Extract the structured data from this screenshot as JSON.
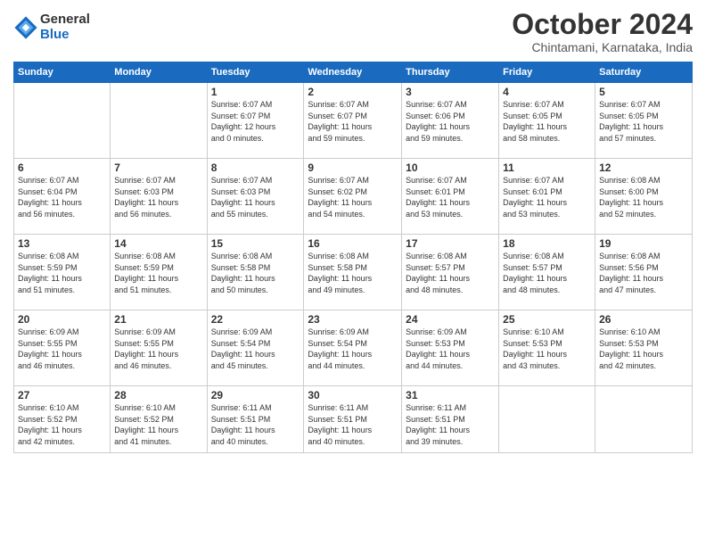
{
  "header": {
    "logo": {
      "general": "General",
      "blue": "Blue"
    },
    "title": "October 2024",
    "location": "Chintamani, Karnataka, India"
  },
  "calendar": {
    "days_of_week": [
      "Sunday",
      "Monday",
      "Tuesday",
      "Wednesday",
      "Thursday",
      "Friday",
      "Saturday"
    ],
    "weeks": [
      [
        {
          "day": "",
          "info": ""
        },
        {
          "day": "",
          "info": ""
        },
        {
          "day": "1",
          "info": "Sunrise: 6:07 AM\nSunset: 6:07 PM\nDaylight: 12 hours\nand 0 minutes."
        },
        {
          "day": "2",
          "info": "Sunrise: 6:07 AM\nSunset: 6:07 PM\nDaylight: 11 hours\nand 59 minutes."
        },
        {
          "day": "3",
          "info": "Sunrise: 6:07 AM\nSunset: 6:06 PM\nDaylight: 11 hours\nand 59 minutes."
        },
        {
          "day": "4",
          "info": "Sunrise: 6:07 AM\nSunset: 6:05 PM\nDaylight: 11 hours\nand 58 minutes."
        },
        {
          "day": "5",
          "info": "Sunrise: 6:07 AM\nSunset: 6:05 PM\nDaylight: 11 hours\nand 57 minutes."
        }
      ],
      [
        {
          "day": "6",
          "info": "Sunrise: 6:07 AM\nSunset: 6:04 PM\nDaylight: 11 hours\nand 56 minutes."
        },
        {
          "day": "7",
          "info": "Sunrise: 6:07 AM\nSunset: 6:03 PM\nDaylight: 11 hours\nand 56 minutes."
        },
        {
          "day": "8",
          "info": "Sunrise: 6:07 AM\nSunset: 6:03 PM\nDaylight: 11 hours\nand 55 minutes."
        },
        {
          "day": "9",
          "info": "Sunrise: 6:07 AM\nSunset: 6:02 PM\nDaylight: 11 hours\nand 54 minutes."
        },
        {
          "day": "10",
          "info": "Sunrise: 6:07 AM\nSunset: 6:01 PM\nDaylight: 11 hours\nand 53 minutes."
        },
        {
          "day": "11",
          "info": "Sunrise: 6:07 AM\nSunset: 6:01 PM\nDaylight: 11 hours\nand 53 minutes."
        },
        {
          "day": "12",
          "info": "Sunrise: 6:08 AM\nSunset: 6:00 PM\nDaylight: 11 hours\nand 52 minutes."
        }
      ],
      [
        {
          "day": "13",
          "info": "Sunrise: 6:08 AM\nSunset: 5:59 PM\nDaylight: 11 hours\nand 51 minutes."
        },
        {
          "day": "14",
          "info": "Sunrise: 6:08 AM\nSunset: 5:59 PM\nDaylight: 11 hours\nand 51 minutes."
        },
        {
          "day": "15",
          "info": "Sunrise: 6:08 AM\nSunset: 5:58 PM\nDaylight: 11 hours\nand 50 minutes."
        },
        {
          "day": "16",
          "info": "Sunrise: 6:08 AM\nSunset: 5:58 PM\nDaylight: 11 hours\nand 49 minutes."
        },
        {
          "day": "17",
          "info": "Sunrise: 6:08 AM\nSunset: 5:57 PM\nDaylight: 11 hours\nand 48 minutes."
        },
        {
          "day": "18",
          "info": "Sunrise: 6:08 AM\nSunset: 5:57 PM\nDaylight: 11 hours\nand 48 minutes."
        },
        {
          "day": "19",
          "info": "Sunrise: 6:08 AM\nSunset: 5:56 PM\nDaylight: 11 hours\nand 47 minutes."
        }
      ],
      [
        {
          "day": "20",
          "info": "Sunrise: 6:09 AM\nSunset: 5:55 PM\nDaylight: 11 hours\nand 46 minutes."
        },
        {
          "day": "21",
          "info": "Sunrise: 6:09 AM\nSunset: 5:55 PM\nDaylight: 11 hours\nand 46 minutes."
        },
        {
          "day": "22",
          "info": "Sunrise: 6:09 AM\nSunset: 5:54 PM\nDaylight: 11 hours\nand 45 minutes."
        },
        {
          "day": "23",
          "info": "Sunrise: 6:09 AM\nSunset: 5:54 PM\nDaylight: 11 hours\nand 44 minutes."
        },
        {
          "day": "24",
          "info": "Sunrise: 6:09 AM\nSunset: 5:53 PM\nDaylight: 11 hours\nand 44 minutes."
        },
        {
          "day": "25",
          "info": "Sunrise: 6:10 AM\nSunset: 5:53 PM\nDaylight: 11 hours\nand 43 minutes."
        },
        {
          "day": "26",
          "info": "Sunrise: 6:10 AM\nSunset: 5:53 PM\nDaylight: 11 hours\nand 42 minutes."
        }
      ],
      [
        {
          "day": "27",
          "info": "Sunrise: 6:10 AM\nSunset: 5:52 PM\nDaylight: 11 hours\nand 42 minutes."
        },
        {
          "day": "28",
          "info": "Sunrise: 6:10 AM\nSunset: 5:52 PM\nDaylight: 11 hours\nand 41 minutes."
        },
        {
          "day": "29",
          "info": "Sunrise: 6:11 AM\nSunset: 5:51 PM\nDaylight: 11 hours\nand 40 minutes."
        },
        {
          "day": "30",
          "info": "Sunrise: 6:11 AM\nSunset: 5:51 PM\nDaylight: 11 hours\nand 40 minutes."
        },
        {
          "day": "31",
          "info": "Sunrise: 6:11 AM\nSunset: 5:51 PM\nDaylight: 11 hours\nand 39 minutes."
        },
        {
          "day": "",
          "info": ""
        },
        {
          "day": "",
          "info": ""
        }
      ]
    ]
  }
}
